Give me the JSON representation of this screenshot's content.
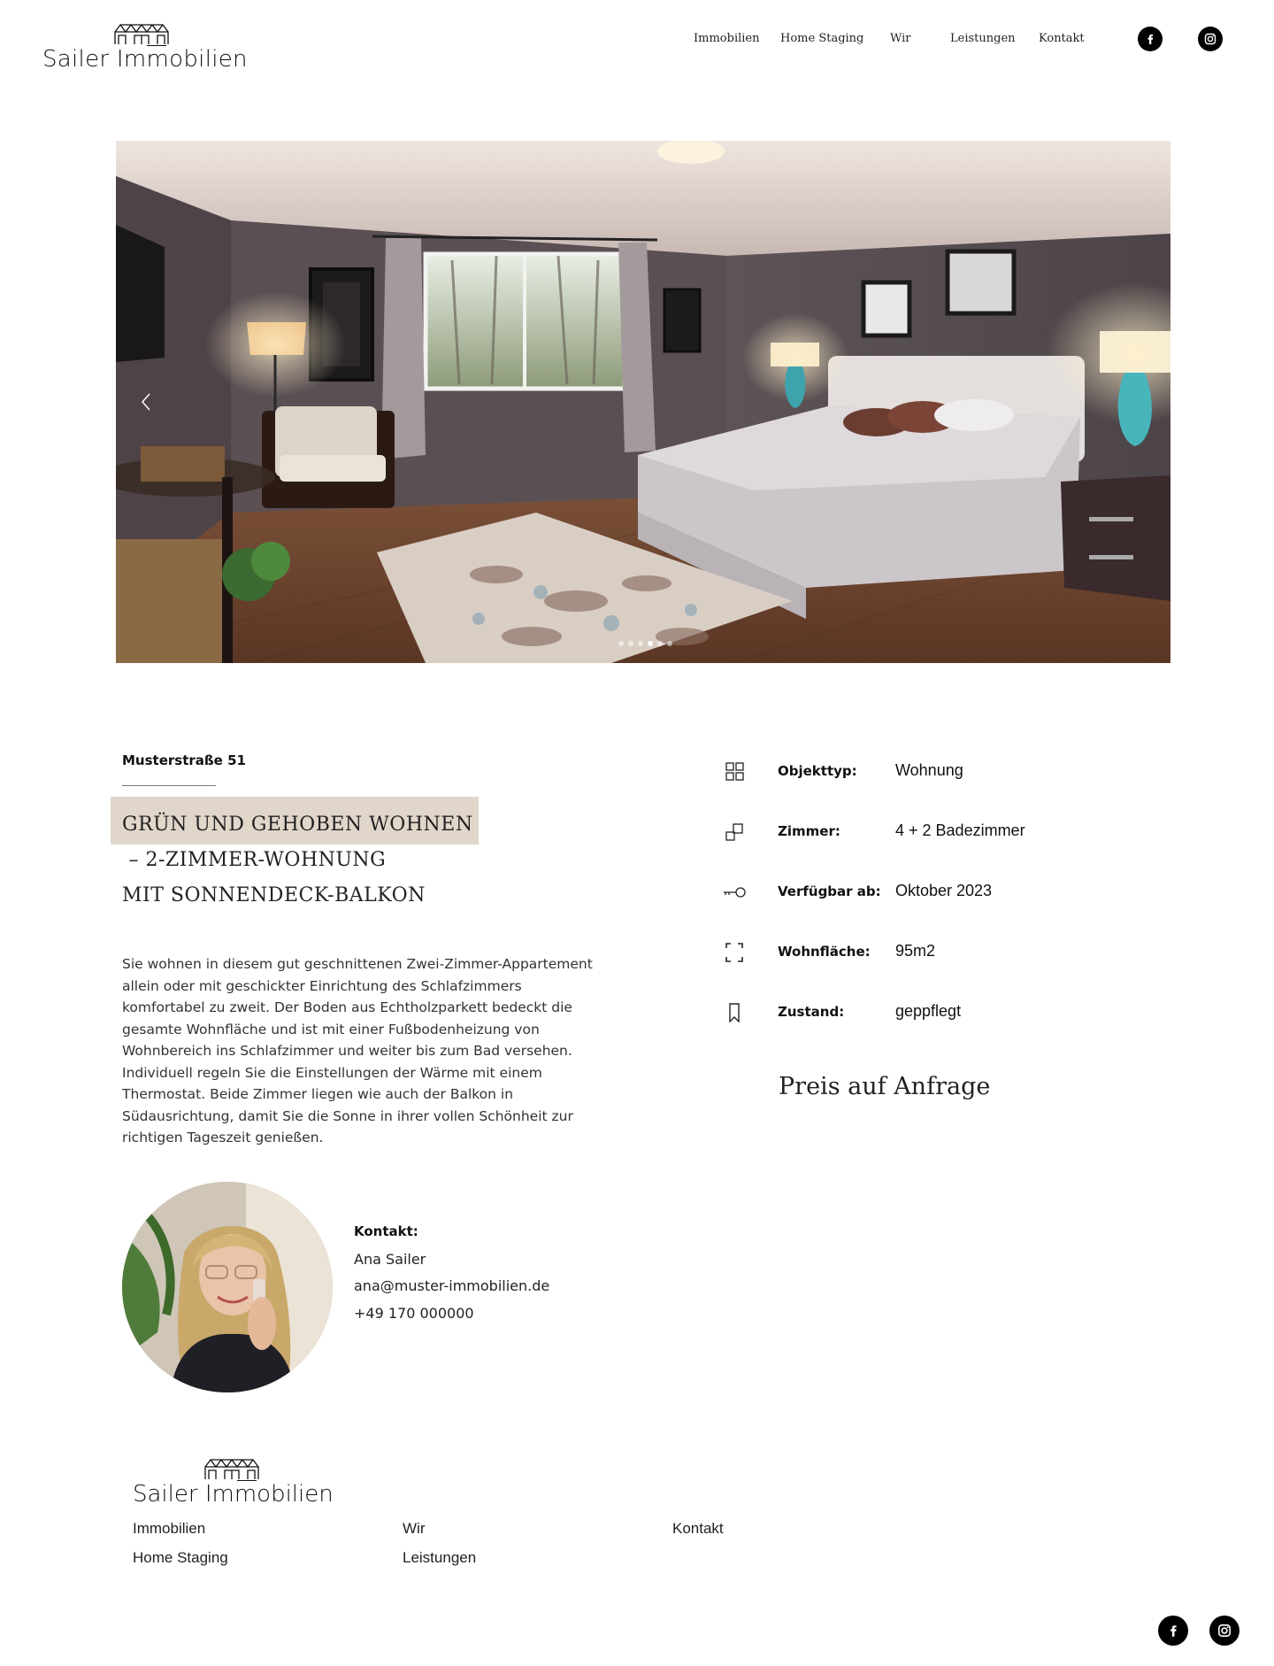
{
  "header": {
    "logo_text": "Sailer Immobilien",
    "nav": [
      "Immobilien",
      "Home Staging",
      "Wir",
      "Leistungen",
      "Kontakt"
    ],
    "social": [
      "facebook-icon",
      "instagram-icon"
    ]
  },
  "hero": {
    "slide_count": 6,
    "active_slide": 4
  },
  "listing": {
    "street": "Musterstraße 51",
    "title_lines": [
      "GRÜN UND GEHOBEN WOHNEN",
      " – 2-ZIMMER-WOHNUNG",
      "MIT SONNENDECK-BALKON"
    ],
    "description": "Sie wohnen in diesem gut geschnittenen Zwei-Zimmer-Appartement allein oder mit geschickter Einrichtung des Schlafzimmers komfortabel zu zweit. Der Boden aus Echtholzparkett bedeckt die gesamte Wohnfläche und ist mit einer Fußbodenheizung von Wohnbereich ins Schlafzimmer und weiter bis zum Bad versehen. Individuell regeln Sie die Einstellungen der Wärme mit einem Thermostat. Beide Zimmer liegen wie auch der Balkon in Südausrichtung, damit Sie die Sonne in ihrer vollen Schönheit zur richtigen Tageszeit genießen.",
    "specs": [
      {
        "icon": "grid-icon",
        "label": "Objekttyp:",
        "value": "Wohnung"
      },
      {
        "icon": "rooms-icon",
        "label": "Zimmer:",
        "value": "4 + 2 Badezimmer"
      },
      {
        "icon": "key-icon",
        "label": "Verfügbar ab:",
        "value": "Oktober 2023"
      },
      {
        "icon": "area-icon",
        "label": "Wohnfläche:",
        "value": "95m2"
      },
      {
        "icon": "bookmark-icon",
        "label": "Zustand:",
        "value": "geppflegt"
      }
    ],
    "price": "Preis auf Anfrage"
  },
  "contact": {
    "label": "Kontakt:",
    "name": "Ana Sailer",
    "email": "ana@muster-immobilien.de",
    "phone": "+49 170 000000"
  },
  "footer": {
    "logo_text": "Sailer Immobilien",
    "links": [
      "Immobilien",
      "Home Staging",
      "Wir",
      "Leistungen",
      "Kontakt"
    ]
  }
}
